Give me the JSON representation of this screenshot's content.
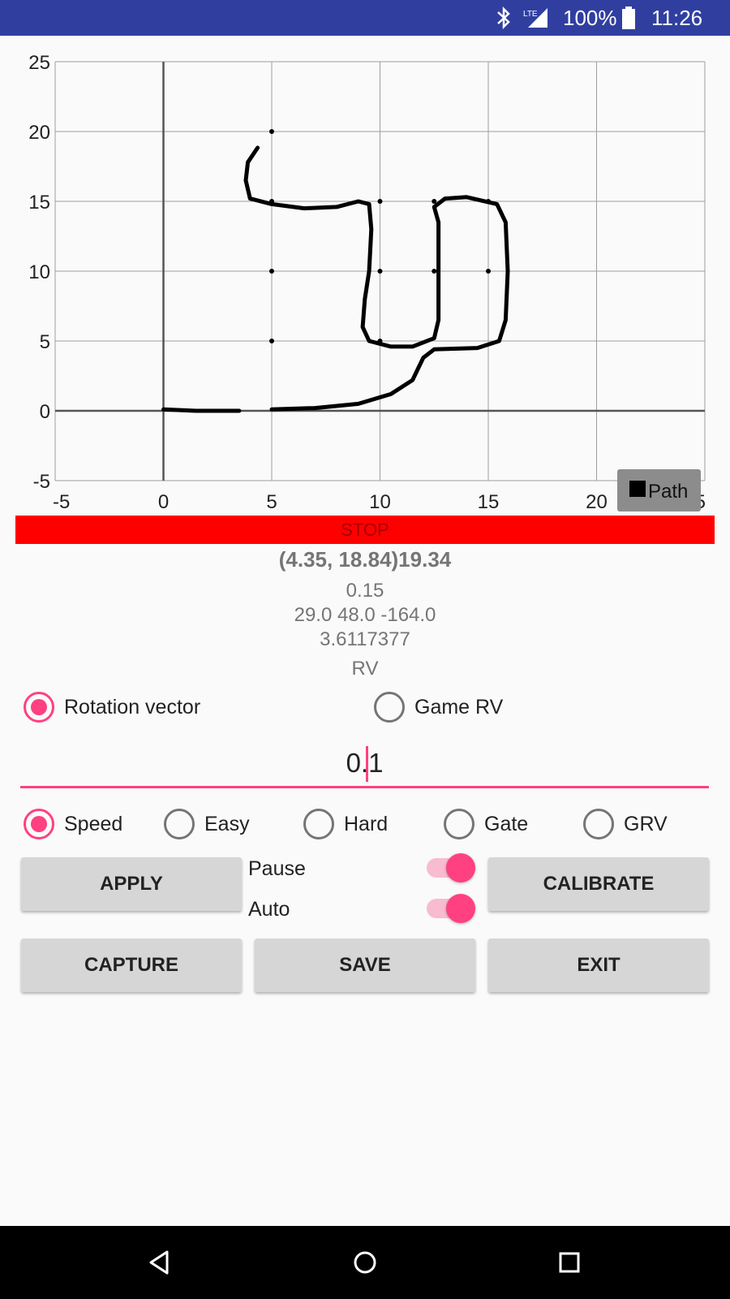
{
  "status_bar": {
    "battery_pct": "100%",
    "time": "11:26",
    "network": "LTE",
    "bg_color": "#303f9f"
  },
  "chart_data": {
    "type": "scatter",
    "xlim": [
      -5,
      25
    ],
    "ylim": [
      -5,
      25
    ],
    "x_ticks": [
      "-5",
      "0",
      "5",
      "10",
      "15",
      "20",
      "25"
    ],
    "y_ticks": [
      "25",
      "20",
      "15",
      "10",
      "5",
      "0",
      "-5"
    ],
    "grid": true,
    "legend": {
      "label": "Path",
      "placement": "bottom-right"
    },
    "series": [
      {
        "name": "Path",
        "style": "line",
        "color": "#000000",
        "segments": [
          [
            [
              0,
              0.1
            ],
            [
              1.5,
              0.0
            ],
            [
              3.5,
              0.0
            ]
          ],
          [
            [
              5.0,
              0.1
            ],
            [
              7.0,
              0.2
            ],
            [
              9.0,
              0.5
            ],
            [
              10.5,
              1.2
            ],
            [
              11.5,
              2.2
            ],
            [
              12.0,
              3.8
            ],
            [
              12.5,
              4.4
            ],
            [
              14.5,
              4.5
            ],
            [
              15.5,
              5.0
            ],
            [
              15.8,
              6.5
            ],
            [
              15.9,
              10.0
            ],
            [
              15.8,
              13.5
            ],
            [
              15.4,
              14.8
            ],
            [
              14.0,
              15.3
            ],
            [
              13.0,
              15.2
            ],
            [
              12.5,
              14.6
            ],
            [
              12.7,
              13.5
            ],
            [
              12.7,
              10.0
            ],
            [
              12.7,
              6.5
            ],
            [
              12.5,
              5.2
            ],
            [
              11.5,
              4.6
            ],
            [
              10.5,
              4.6
            ],
            [
              9.5,
              5.0
            ],
            [
              9.2,
              6.0
            ],
            [
              9.3,
              8.0
            ],
            [
              9.5,
              10.0
            ],
            [
              9.6,
              13.0
            ],
            [
              9.5,
              14.8
            ],
            [
              9.0,
              15.0
            ],
            [
              8.0,
              14.6
            ],
            [
              6.5,
              14.5
            ],
            [
              5.0,
              14.8
            ],
            [
              4.0,
              15.2
            ],
            [
              3.8,
              16.5
            ],
            [
              3.9,
              17.8
            ],
            [
              4.35,
              18.84
            ]
          ]
        ]
      },
      {
        "name": "markers",
        "style": "points",
        "points": [
          [
            5,
            20
          ],
          [
            5,
            15
          ],
          [
            5,
            10
          ],
          [
            5,
            5
          ],
          [
            10,
            15
          ],
          [
            10,
            10
          ],
          [
            10,
            5
          ],
          [
            12.5,
            15
          ],
          [
            12.5,
            10
          ],
          [
            15,
            15
          ],
          [
            15,
            10
          ]
        ]
      }
    ]
  },
  "stop_bar": {
    "label": "STOP",
    "color": "#ff0000"
  },
  "info": {
    "coords": "(4.35, 18.84)19.34",
    "line1": "0.15",
    "line2": "29.0  48.0  -164.0",
    "line3": "3.6117377",
    "mode": "RV"
  },
  "sensor_radio": {
    "options": [
      {
        "label": "Rotation vector",
        "checked": true
      },
      {
        "label": "Game RV",
        "checked": false
      }
    ]
  },
  "input": {
    "value": "0.1"
  },
  "mode_radio": {
    "options": [
      {
        "label": "Speed",
        "checked": true
      },
      {
        "label": "Easy",
        "checked": false
      },
      {
        "label": "Hard",
        "checked": false
      },
      {
        "label": "Gate",
        "checked": false
      },
      {
        "label": "GRV",
        "checked": false
      }
    ]
  },
  "buttons": {
    "apply": "APPLY",
    "calibrate": "CALIBRATE",
    "capture": "CAPTURE",
    "save": "SAVE",
    "exit": "EXIT"
  },
  "switches": {
    "pause": {
      "label": "Pause",
      "on": true
    },
    "auto": {
      "label": "Auto",
      "on": true
    }
  },
  "accent_color": "#ff4081"
}
